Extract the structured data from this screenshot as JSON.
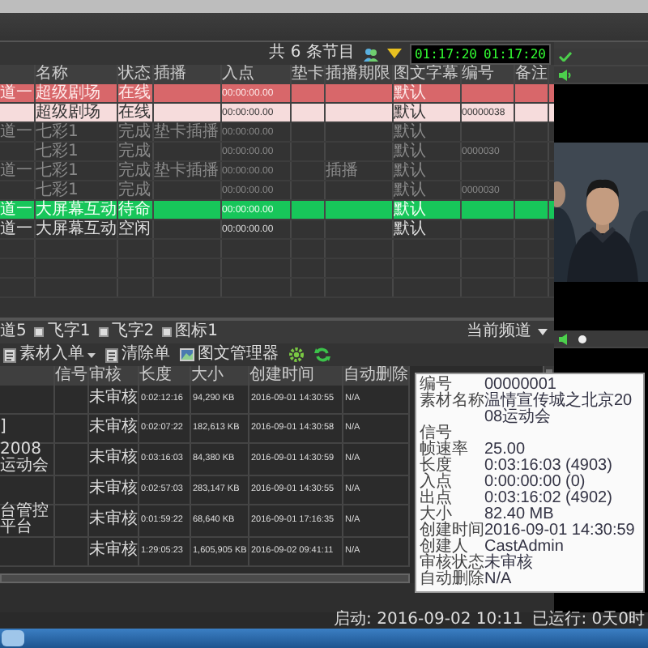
{
  "toolbar": {
    "program_count": "共 6 条节目",
    "timecode_elapsed": "01:17:20",
    "timecode_remaining": "01:17:20"
  },
  "schedule": {
    "columns": [
      "名称",
      "状态",
      "插播",
      "入点",
      "垫卡",
      "插播期限",
      "图文字幕",
      "编号",
      "备注"
    ],
    "rows": [
      {
        "channel": "道一",
        "name": "超级剧场",
        "status": "在线",
        "in_point": "00:00:00.00",
        "caption": "默认",
        "kind": "alert",
        "selected": false,
        "disabled": false
      },
      {
        "name": "超级剧场",
        "status": "在线",
        "in_point": "00:00:00.00",
        "caption": "默认",
        "number": "00000038",
        "kind": "normal",
        "selected": true,
        "disabled": false
      },
      {
        "channel": "道一",
        "name": "七彩1",
        "status": "完成",
        "insert": "垫卡插播",
        "in_point": "00:00:00.00",
        "caption": "默认",
        "kind": "normal",
        "selected": false,
        "disabled": true
      },
      {
        "name": "七彩1",
        "status": "完成",
        "in_point": "00:00:00.00",
        "caption": "默认",
        "number": "0000030",
        "kind": "normal",
        "selected": false,
        "disabled": true
      },
      {
        "channel": "道一",
        "name": "七彩1",
        "status": "完成",
        "insert": "垫卡插播",
        "in_point": "00:00:00.00",
        "insert_limit": "插播",
        "caption": "默认",
        "kind": "normal",
        "selected": false,
        "disabled": true
      },
      {
        "name": "七彩1",
        "status": "完成",
        "in_point": "00:00:00.00",
        "caption": "默认",
        "number": "0000030",
        "kind": "normal",
        "selected": false,
        "disabled": true
      },
      {
        "channel": "道一",
        "name": "大屏幕互动",
        "status": "待命",
        "in_point": "00:00:00.00",
        "caption": "默认",
        "kind": "cued",
        "selected": false,
        "disabled": false
      },
      {
        "channel": "道一",
        "name": "大屏幕互动",
        "status": "空闲",
        "in_point": "00:00:00.00",
        "caption": "默认",
        "kind": "normal",
        "selected": false,
        "disabled": false
      }
    ]
  },
  "overlay_bar": {
    "leading_label": "道5",
    "options": [
      {
        "label": "飞字1",
        "checked": true
      },
      {
        "label": "飞字2",
        "checked": true
      },
      {
        "label": "图标1",
        "checked": true
      }
    ],
    "channel_dropdown": "当前频道"
  },
  "material_toolbar": {
    "buttons": [
      {
        "label": "素材入单",
        "has_menu": true
      },
      {
        "label": "清除单",
        "has_menu": false
      },
      {
        "label": "图文管理器",
        "has_menu": false
      }
    ]
  },
  "materials": {
    "columns": [
      "信号",
      "审核",
      "长度",
      "大小",
      "创建时间",
      "自动删除"
    ],
    "rows": [
      {
        "review": "未审核",
        "duration": "0:02:12:16",
        "size": "94,290 KB",
        "created": "2016-09-01 14:30:55",
        "auto_delete": "N/A"
      },
      {
        "name": "]",
        "review": "未审核",
        "duration": "0:02:07:22",
        "size": "182,613 KB",
        "created": "2016-09-01 14:30:58",
        "auto_delete": "N/A"
      },
      {
        "name": "2008运动会",
        "review": "未审核",
        "duration": "0:03:16:03",
        "size": "84,380 KB",
        "created": "2016-09-01 14:30:59",
        "auto_delete": "N/A"
      },
      {
        "review": "未审核",
        "duration": "0:02:57:03",
        "size": "283,147 KB",
        "created": "2016-09-01 14:30:55",
        "auto_delete": "N/A"
      },
      {
        "name": "台管控平台",
        "review": "未审核",
        "duration": "0:01:59:22",
        "size": "68,640 KB",
        "created": "2016-09-01 17:16:35",
        "auto_delete": "N/A"
      },
      {
        "review": "未审核",
        "duration": "1:29:05:23",
        "size": "1,605,905 KB",
        "created": "2016-09-02 09:41:11",
        "auto_delete": "N/A"
      }
    ]
  },
  "tooltip": [
    {
      "label": "编号",
      "value": "00000001"
    },
    {
      "label": "素材名称",
      "value": "温情宣传城之北京2008运动会"
    },
    {
      "label": "信号"
    },
    {
      "label": "帧速率",
      "value": "25.00"
    },
    {
      "label": "长度",
      "value": "0:03:16:03 (4903)"
    },
    {
      "label": "入点",
      "value": "0:00:00:00 (0)"
    },
    {
      "label": "出点",
      "value": "0:03:16:02 (4902)"
    },
    {
      "label": "大小",
      "value": "82.40 MB"
    },
    {
      "label": "创建时间",
      "value": "2016-09-01 14:30:59"
    },
    {
      "label": "创建人",
      "value": "CastAdmin"
    },
    {
      "label": "审核状态",
      "value": "未审核"
    },
    {
      "label": "自动删除",
      "value": "N/A"
    }
  ],
  "status_bar": {
    "started": "启动: 2016-09-02 10:11",
    "running": "已运行: 0天0时"
  }
}
